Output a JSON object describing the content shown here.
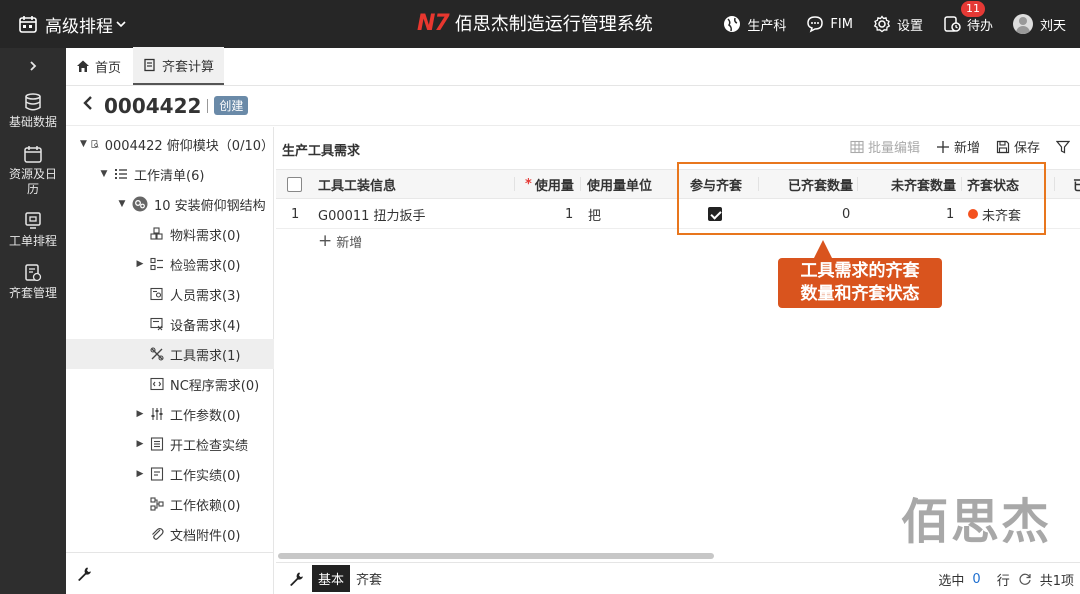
{
  "topbar": {
    "app_title": "高级排程",
    "brand_logo": "N7",
    "brand_title": "佰思杰制造运行管理系统",
    "items": {
      "dept": "生产科",
      "fim": "FIM",
      "settings": "设置",
      "todo": "待办",
      "todo_badge": "11",
      "user": "刘天"
    }
  },
  "leftnav": {
    "items": [
      {
        "label": "基础数据"
      },
      {
        "label": "资源及日历"
      },
      {
        "label": "工单排程"
      },
      {
        "label": "齐套管理"
      }
    ]
  },
  "tabs": {
    "home": "首页",
    "kit_calc": "齐套计算"
  },
  "header": {
    "code": "0004422",
    "status": "创建"
  },
  "tree": {
    "root": "0004422 俯仰模块（0/10）",
    "work_list": "工作清单(6)",
    "op": "10 安装俯仰钢结构",
    "children": [
      "物料需求(0)",
      "检验需求(0)",
      "人员需求(3)",
      "设备需求(4)",
      "工具需求(1)",
      "NC程序需求(0)",
      "工作参数(0)",
      "开工检查实绩",
      "工作实绩(0)",
      "工作依赖(0)",
      "文档附件(0)"
    ]
  },
  "panel": {
    "title": "生产工具需求",
    "tools": {
      "batch_edit": "批量编辑",
      "add": "新增",
      "save": "保存"
    },
    "columns": {
      "tool_info": "工具工装信息",
      "qty": "使用量",
      "unit": "使用量单位",
      "join_kit": "参与齐套",
      "kitted_qty": "已齐套数量",
      "unkitted_qty": "未齐套数量",
      "kit_status": "齐套状态",
      "more": "已"
    },
    "rows": [
      {
        "index": "1",
        "tool_info": "G00011 扭力扳手",
        "qty": "1",
        "unit": "把",
        "join_kit": true,
        "kitted_qty": "0",
        "unkitted_qty": "1",
        "kit_status": "未齐套"
      }
    ],
    "add_row": "新增",
    "callout_line1": "工具需求的齐套",
    "callout_line2": "数量和齐套状态"
  },
  "watermark": "佰思杰",
  "footer": {
    "tab_basic": "基本",
    "tab_kit": "齐套",
    "selected_label": "选中",
    "selected_count": "0",
    "row_label": "行",
    "total": "共1项"
  },
  "colors": {
    "topbar_bg": "#262626",
    "leftnav_bg": "#2e2e2e",
    "brand_red": "#e8372f",
    "highlight_orange": "#e8761d",
    "callout_bg": "#d9541e",
    "status_dot": "#f4511e",
    "link_blue": "#1e6fd0"
  }
}
